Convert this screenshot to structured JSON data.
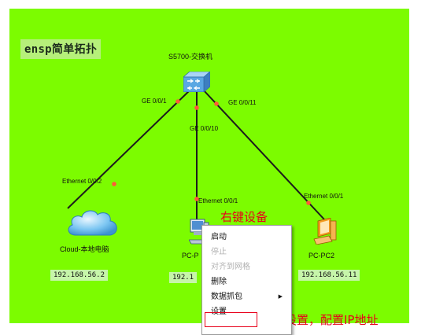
{
  "topology": {
    "title": "ensp简单拓扑",
    "canvas_color": "#7CFC00",
    "switch": {
      "name": "S5700-交换机",
      "icon": "switch-icon",
      "ports": [
        "GE 0/0/1",
        "GE 0/0/10",
        "GE 0/0/11"
      ]
    },
    "cloud": {
      "name": "Cloud-本地电脑",
      "icon": "cloud-icon",
      "port": "Ethernet 0/0/2",
      "ip": "192.168.56.2"
    },
    "pc1": {
      "name": "PC-P",
      "icon": "pc-icon",
      "port": "Ethernet 0/0/1",
      "ip": "192.1"
    },
    "pc2": {
      "name": "PC-PC2",
      "icon": "pc-icon",
      "port": "Ethernet 0/0/1",
      "ip": "192.168.56.11"
    }
  },
  "annotations": {
    "right_click": "右键设备",
    "settings_hint": "点击设置，配置IP地址",
    "color": "#e8001a"
  },
  "context_menu": {
    "items": [
      {
        "label": "启动",
        "enabled": true
      },
      {
        "label": "停止",
        "enabled": false
      },
      {
        "label": "对齐到网格",
        "enabled": false
      },
      {
        "label": "删除",
        "enabled": true
      },
      {
        "label": "数据抓包",
        "enabled": true,
        "submenu": true
      },
      {
        "label": "设置",
        "enabled": true,
        "highlighted": true
      }
    ]
  }
}
